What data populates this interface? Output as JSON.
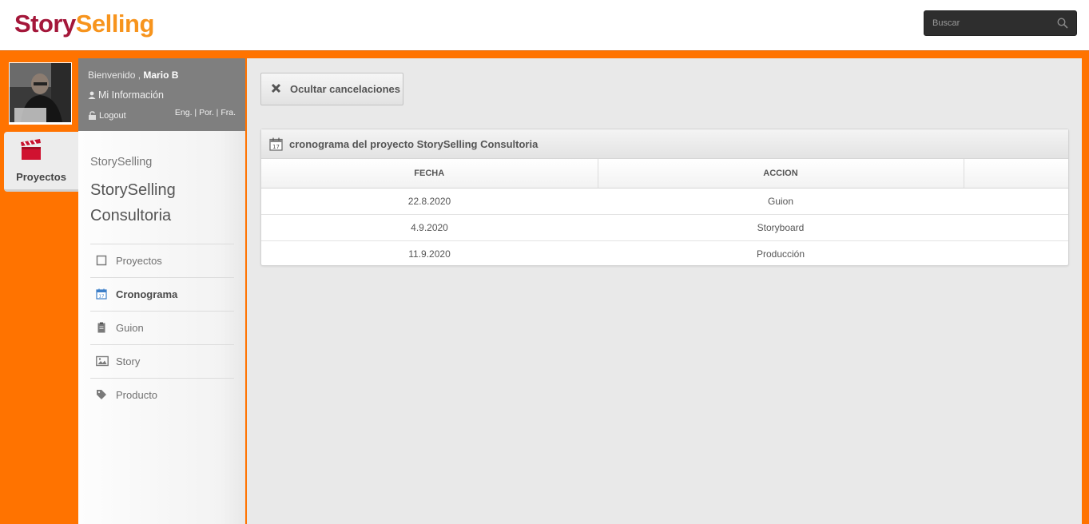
{
  "header": {
    "logo_part1": "Story",
    "logo_part2": "Selling",
    "search_placeholder": "Buscar"
  },
  "user": {
    "welcome": "Bienvenido ,",
    "name": "Mario B",
    "my_info": "Mi Información",
    "logout": "Logout",
    "languages": [
      "Eng.",
      "Por.",
      "Fra."
    ]
  },
  "left_tab": {
    "label": "Proyectos"
  },
  "sidebar": {
    "breadcrumb": "StorySelling",
    "project_title": "StorySelling Consultoria",
    "items": [
      {
        "label": "Proyectos",
        "icon": "square-icon",
        "active": false
      },
      {
        "label": "Cronograma",
        "icon": "calendar-icon",
        "active": true
      },
      {
        "label": "Guion",
        "icon": "clipboard-icon",
        "active": false
      },
      {
        "label": "Story",
        "icon": "image-icon",
        "active": false
      },
      {
        "label": "Producto",
        "icon": "tags-icon",
        "active": false
      }
    ]
  },
  "main": {
    "hide_button": "Ocultar cancelaciones",
    "panel_title": "cronograma del proyecto StorySelling Consultoria",
    "table": {
      "columns": [
        "FECHA",
        "ACCION",
        ""
      ],
      "rows": [
        [
          "22.8.2020",
          "Guion",
          ""
        ],
        [
          "4.9.2020",
          "Storyboard",
          ""
        ],
        [
          "11.9.2020",
          "Producción",
          ""
        ]
      ]
    }
  },
  "colors": {
    "brand_orange": "#ff7300",
    "logo_red": "#a4173a",
    "logo_orange": "#f7941d",
    "active_icon_blue": "#3d7fc9"
  }
}
